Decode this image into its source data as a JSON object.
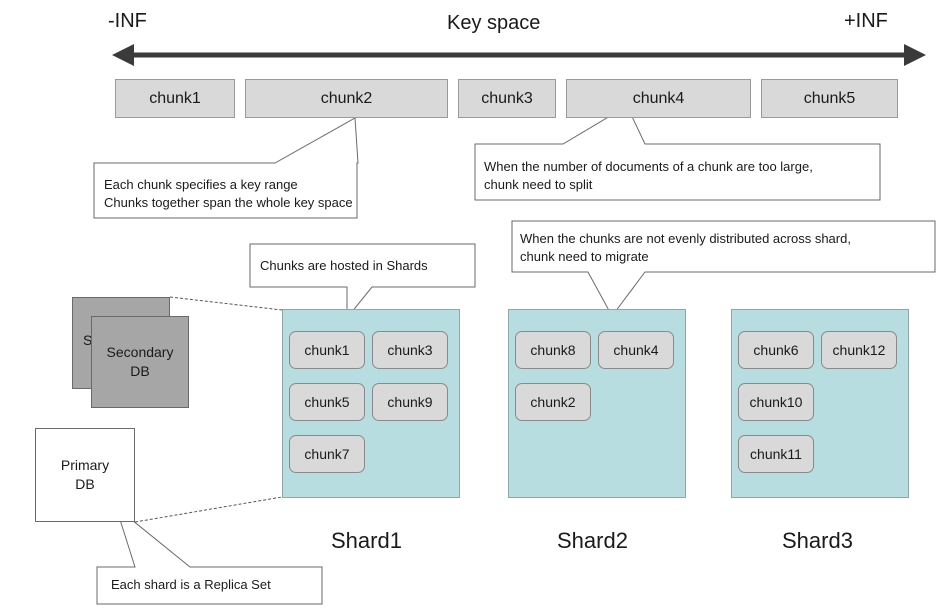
{
  "key_space": {
    "left_label": "-INF",
    "title": "Key space",
    "right_label": "+INF"
  },
  "key_chunks": [
    "chunk1",
    "chunk2",
    "chunk3",
    "chunk4",
    "chunk5"
  ],
  "callouts": {
    "key_range": [
      "Each chunk specifies a key range",
      "Chunks together span the whole key space"
    ],
    "split": [
      "When the number of documents of a chunk are too large,",
      "chunk need to split"
    ],
    "migrate": [
      "When the chunks are not evenly distributed across shard,",
      "chunk need to migrate"
    ],
    "hosted": "Chunks are hosted in Shards",
    "replica": "Each shard is a Replica Set"
  },
  "shards": [
    {
      "name": "Shard1",
      "chunks": [
        "chunk1",
        "chunk3",
        "chunk5",
        "chunk9",
        "chunk7"
      ]
    },
    {
      "name": "Shard2",
      "chunks": [
        "chunk8",
        "chunk4",
        "chunk2"
      ]
    },
    {
      "name": "Shard3",
      "chunks": [
        "chunk6",
        "chunk12",
        "chunk10",
        "chunk11"
      ]
    }
  ],
  "replica_set": {
    "secondary_back": "S",
    "secondary": [
      "Secondary",
      "DB"
    ],
    "primary": [
      "Primary",
      "DB"
    ]
  },
  "colors": {
    "shard_fill": "#b7dde0",
    "chunk_fill": "#d9d9d9",
    "secondary_fill": "#a6a6a6"
  }
}
